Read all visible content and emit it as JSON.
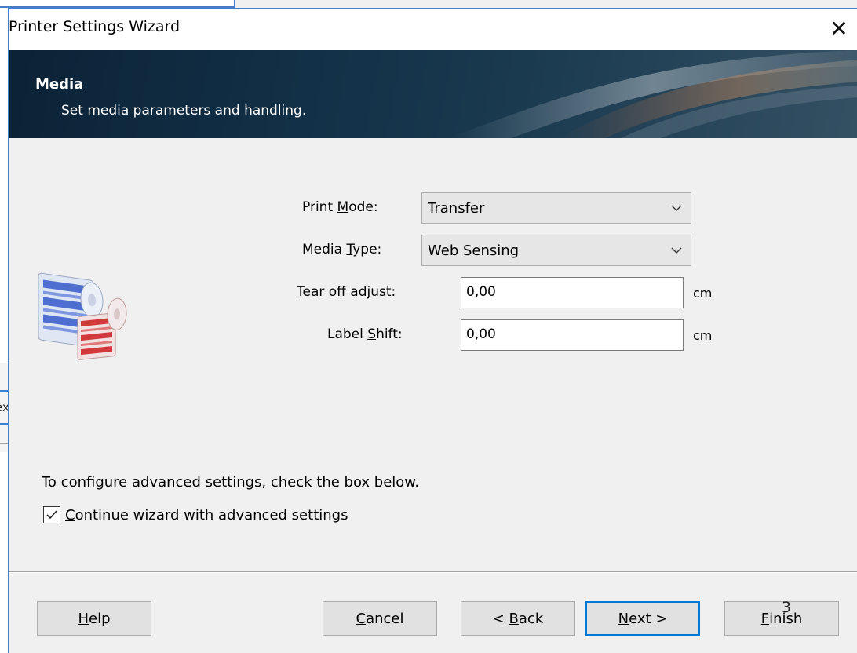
{
  "dialog": {
    "title": "Printer Settings Wizard",
    "close_glyph": "✕"
  },
  "banner": {
    "heading": "Media",
    "subheading": "Set media parameters and handling."
  },
  "form": {
    "print_mode": {
      "label_pre": "Print ",
      "label_ul": "M",
      "label_post": "ode:",
      "value": "Transfer"
    },
    "media_type": {
      "label_pre": "Media ",
      "label_ul": "T",
      "label_post": "ype:",
      "value": "Web Sensing"
    },
    "tear_off": {
      "label_pre": "",
      "label_ul": "T",
      "label_post": "ear off adjust:",
      "value": "0,00",
      "unit": "cm"
    },
    "label_shift": {
      "label_pre": "Label ",
      "label_ul": "S",
      "label_post": "hift:",
      "value": "0,00",
      "unit": "cm"
    }
  },
  "advanced": {
    "info": "To configure advanced settings, check the box below.",
    "checkbox_ul": "C",
    "checkbox_rest": "ontinue wizard with advanced settings",
    "checked": true
  },
  "buttons": {
    "help": {
      "ul": "H",
      "rest": "elp"
    },
    "cancel": {
      "ul": "C",
      "rest": "ancel"
    },
    "back": {
      "pre": "< ",
      "ul": "B",
      "rest": "ack"
    },
    "next": {
      "ul": "N",
      "rest": "ext >"
    },
    "finish": {
      "pre": "",
      "ul": "F",
      "rest": "inish"
    }
  },
  "overlay_number": "3",
  "background_fragment_text": "ex",
  "colors": {
    "accent": "#0078d7",
    "banner_dark": "#0c2236"
  }
}
